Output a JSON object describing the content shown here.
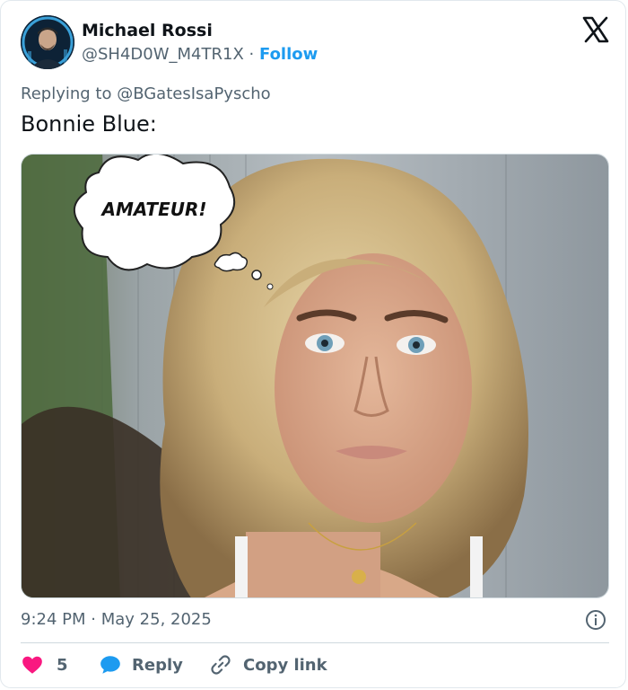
{
  "user": {
    "display_name": "Michael Rossi",
    "handle": "@SH4D0W_M4TR1X",
    "separator": "·",
    "follow_label": "Follow"
  },
  "reply": {
    "prefix": "Replying to ",
    "target": "@BGatesIsaPyscho"
  },
  "tweet": {
    "text": "Bonnie Blue:",
    "image_caption": "AMATEUR!"
  },
  "meta": {
    "time": "9:24 PM",
    "date": "May 25, 2025",
    "separator": "·"
  },
  "actions": {
    "like_count": "5",
    "reply_label": "Reply",
    "copy_label": "Copy link"
  },
  "icons": {
    "brand": "x-logo-icon",
    "info": "info-icon",
    "like": "heart-icon",
    "reply": "reply-bubble-icon",
    "copy": "link-icon"
  },
  "colors": {
    "text": "#0f1419",
    "muted": "#536471",
    "accent": "#1d9bf0",
    "like": "#f91880"
  }
}
